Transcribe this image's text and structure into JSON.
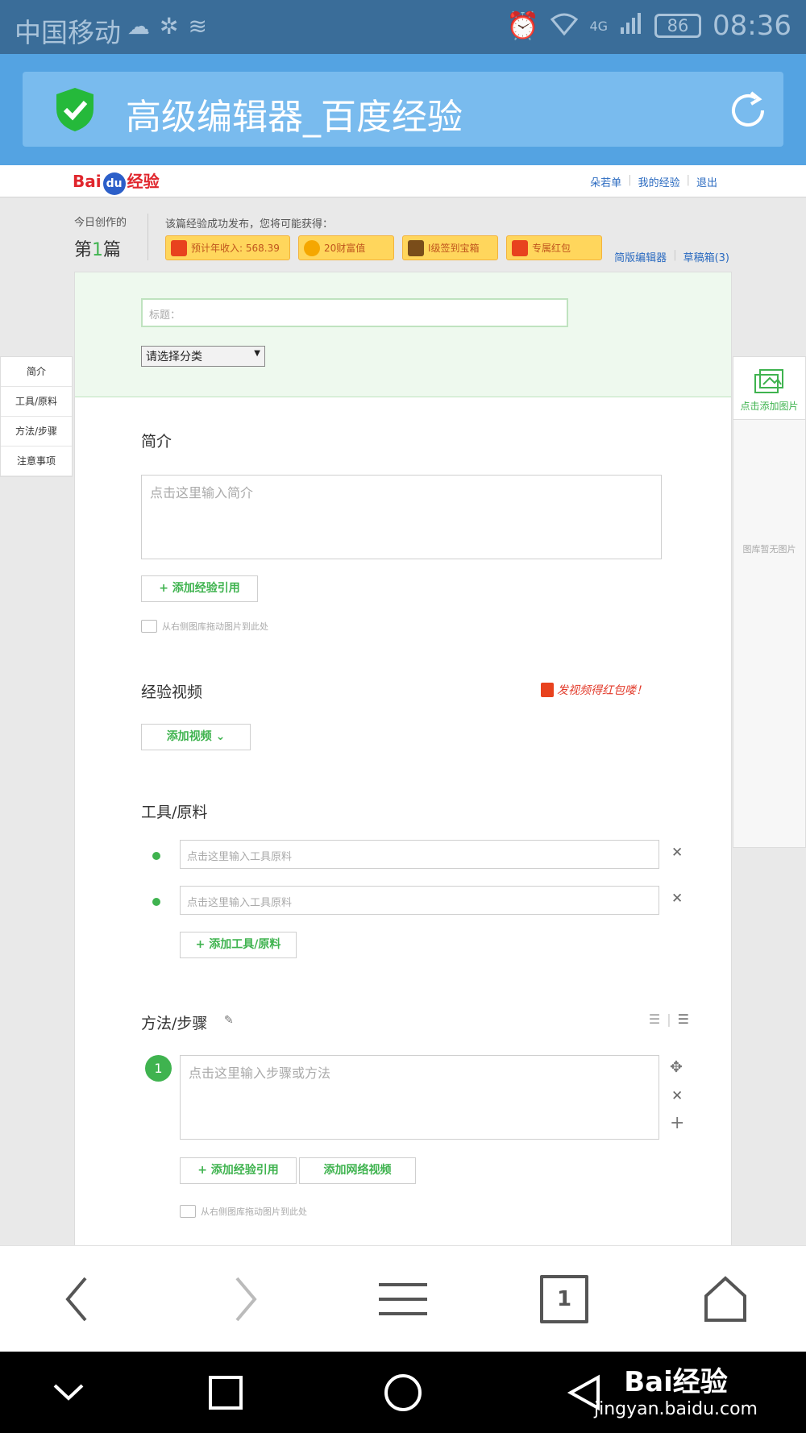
{
  "status_bar": {
    "carrier": "中国移动",
    "signal_type": "4G",
    "battery": "86",
    "time": "08:36"
  },
  "browser": {
    "title": "高级编辑器_百度经验"
  },
  "site_nav": {
    "logo": {
      "bai": "Bai",
      "du": "du",
      "jingyan": "经验"
    },
    "links": [
      "朵若单",
      "我的经验",
      "退出"
    ]
  },
  "stats": {
    "today_label": "今日创作的",
    "today_prefix": "第",
    "today_count": "1",
    "today_suffix": "篇",
    "reward_label": "该篇经验成功发布，您将可能获得：",
    "rewards": [
      "预计年收入: 568.39",
      "20财富值",
      "I级签到宝箱",
      "专属红包"
    ]
  },
  "editor_links": {
    "simple": "简版编辑器",
    "draft": "草稿箱(3)"
  },
  "left_nav": [
    "简介",
    "工具/原料",
    "方法/步骤",
    "注意事项"
  ],
  "gallery": {
    "add_label": "点击添加图片",
    "empty": "图库暂无图片"
  },
  "form": {
    "title_placeholder": "标题：",
    "category": "请选择分类",
    "intro": {
      "heading": "简介",
      "placeholder": "点击这里输入简介",
      "add_ref": "+ 添加经验引用",
      "drag_hint": "从右侧图库拖动图片到此处"
    },
    "video": {
      "heading": "经验视频",
      "promo": "发视频得红包喽！",
      "add_button": "添加视频"
    },
    "tools": {
      "heading": "工具/原料",
      "items": [
        "点击这里输入工具原料",
        "点击这里输入工具原料"
      ],
      "add_button": "+ 添加工具/原料"
    },
    "steps": {
      "heading": "方法/步骤",
      "step_number": "1",
      "placeholder": "点击这里输入步骤或方法",
      "add_ref": "+ 添加经验引用",
      "add_video": "添加网络视频",
      "drag_hint": "从右侧图库拖动图片到此处"
    }
  },
  "browser_bar": {
    "tabs_count": "1"
  },
  "watermark": {
    "brand": "Bai经验",
    "url": "jingyan.baidu.com"
  }
}
